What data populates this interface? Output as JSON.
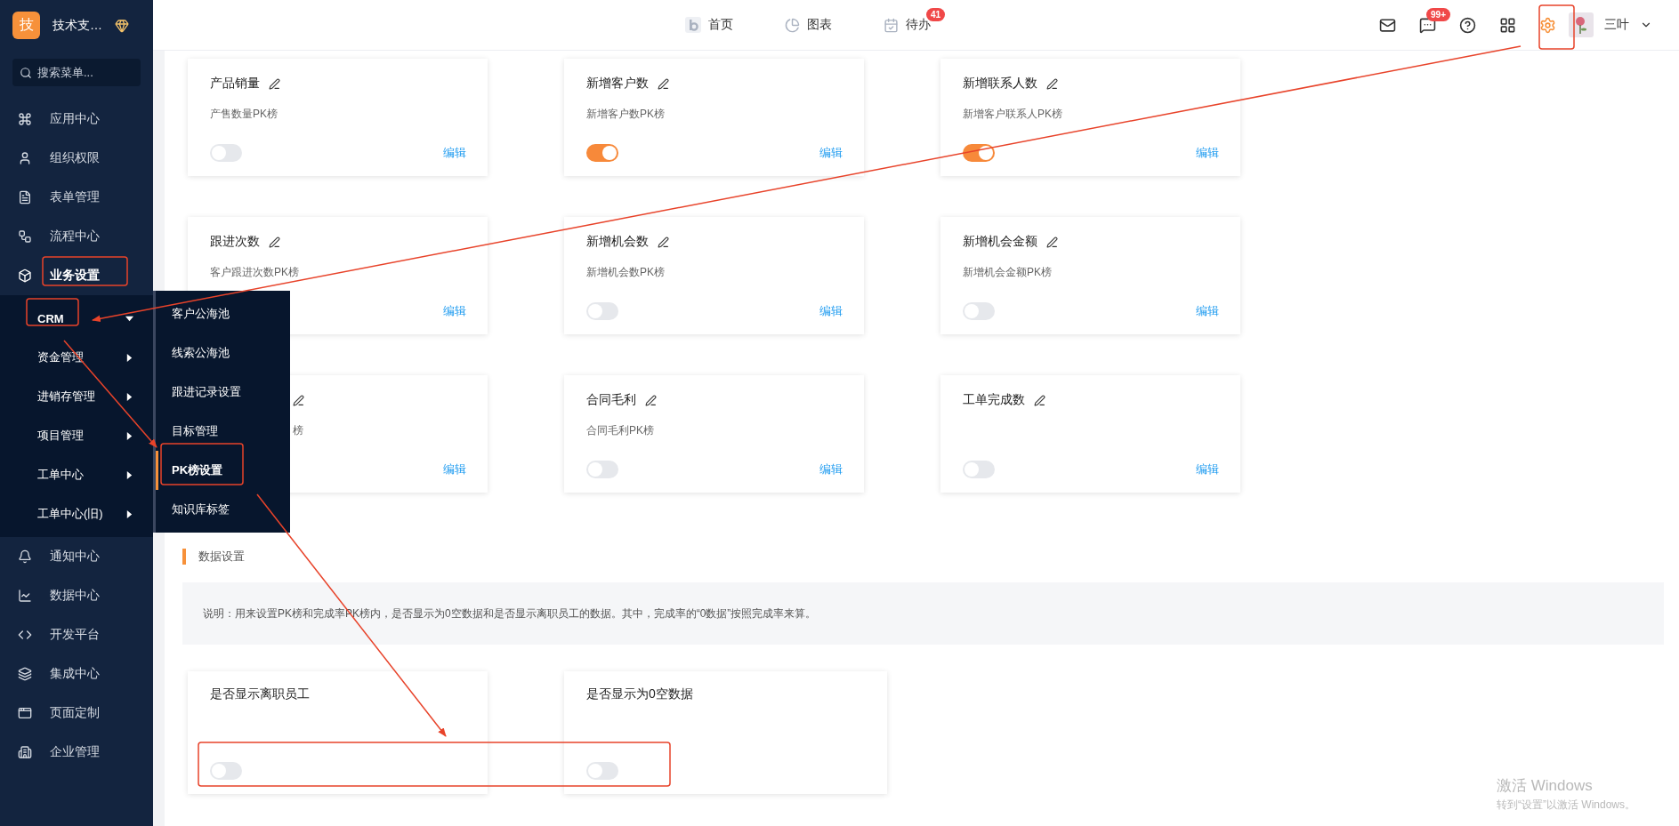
{
  "sidebar": {
    "org": {
      "logo": "技",
      "name": "技术支…"
    },
    "search": {
      "placeholder": "搜索菜单..."
    },
    "items": [
      {
        "label": "应用中心",
        "selected": false
      },
      {
        "label": "组织权限",
        "selected": false
      },
      {
        "label": "表单管理",
        "selected": false
      },
      {
        "label": "流程中心",
        "selected": false
      },
      {
        "label": "业务设置",
        "selected": true,
        "expanded": true,
        "children": [
          {
            "label": "CRM",
            "selected": true,
            "expanded": true,
            "children": [
              {
                "label": "客户公海池",
                "selected": false
              },
              {
                "label": "线索公海池",
                "selected": false
              },
              {
                "label": "跟进记录设置",
                "selected": false
              },
              {
                "label": "目标管理",
                "selected": false
              },
              {
                "label": "PK榜设置",
                "selected": true
              },
              {
                "label": "知识库标签",
                "selected": false
              }
            ]
          },
          {
            "label": "资金管理",
            "selected": false,
            "expanded": false
          },
          {
            "label": "进销存管理",
            "selected": false,
            "expanded": false
          },
          {
            "label": "项目管理",
            "selected": false,
            "expanded": false
          },
          {
            "label": "工单中心",
            "selected": false,
            "expanded": false
          },
          {
            "label": "工单中心(旧)",
            "selected": false,
            "expanded": false
          }
        ]
      },
      {
        "label": "通知中心",
        "selected": false
      },
      {
        "label": "数据中心",
        "selected": false
      },
      {
        "label": "开发平台",
        "selected": false
      },
      {
        "label": "集成中心",
        "selected": false
      },
      {
        "label": "页面定制",
        "selected": false
      },
      {
        "label": "企业管理",
        "selected": false
      }
    ]
  },
  "top_nav": [
    {
      "label": "首页"
    },
    {
      "label": "图表"
    },
    {
      "label": "待办",
      "badge": "41"
    }
  ],
  "toolbar": {
    "message_badge": "99+",
    "user": "三叶"
  },
  "pk_cards": [
    {
      "title": "产品销量",
      "description": "产售数量PK榜",
      "on": false,
      "edit": "编辑"
    },
    {
      "title": "新增客户数",
      "description": "新增客户数PK榜",
      "on": true,
      "edit": "编辑"
    },
    {
      "title": "新增联系人数",
      "description": "新增客户联系人PK榜",
      "on": true,
      "edit": "编辑"
    },
    {
      "title": "跟进次数",
      "description": "客户跟进次数PK榜",
      "edit": "编辑"
    },
    {
      "title": "新增机会数",
      "description": "新增机会数PK榜",
      "on": false,
      "edit": "编辑"
    },
    {
      "title": "新增机会金额",
      "description": "新增机会金额PK榜",
      "on": false,
      "edit": "编辑"
    },
    {
      "title": "合同毛利",
      "description": "合同毛利PK榜",
      "on": false,
      "edit": "编辑"
    },
    {
      "title": "工单完成数",
      "on": false,
      "edit": "编辑"
    }
  ],
  "covered_card": {
    "description": "榜",
    "edit": "编辑"
  },
  "data_settings": {
    "title": "数据设置",
    "note": "说明：用来设置PK榜和完成率PK榜内，是否显示为0空数据和是否显示离职员工的数据。其中，完成率的“0数据”按照完成率来算。",
    "cards": [
      {
        "title": "是否显示离职员工",
        "on": false
      },
      {
        "title": "是否显示为0空数据",
        "on": false
      }
    ]
  },
  "os_notice": {
    "title": "激活 Windows",
    "text": "转到“设置”以激活 Windows。"
  }
}
